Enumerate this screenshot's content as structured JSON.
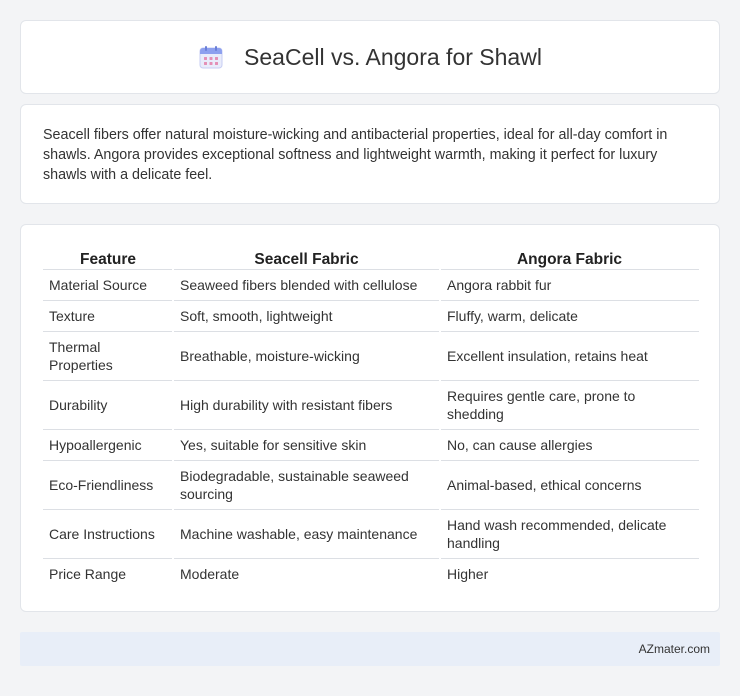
{
  "header": {
    "title": "SeaCell vs. Angora for Shawl",
    "icon": "calendar-icon"
  },
  "summary": {
    "text": "Seacell fibers offer natural moisture-wicking and antibacterial properties, ideal for all-day comfort in shawls. Angora provides exceptional softness and lightweight warmth, making it perfect for luxury shawls with a delicate feel."
  },
  "table": {
    "headers": [
      "Feature",
      "Seacell Fabric",
      "Angora Fabric"
    ],
    "rows": [
      [
        "Material Source",
        "Seaweed fibers blended with cellulose",
        "Angora rabbit fur"
      ],
      [
        "Texture",
        "Soft, smooth, lightweight",
        "Fluffy, warm, delicate"
      ],
      [
        "Thermal Properties",
        "Breathable, moisture-wicking",
        "Excellent insulation, retains heat"
      ],
      [
        "Durability",
        "High durability with resistant fibers",
        "Requires gentle care, prone to shedding"
      ],
      [
        "Hypoallergenic",
        "Yes, suitable for sensitive skin",
        "No, can cause allergies"
      ],
      [
        "Eco-Friendliness",
        "Biodegradable, sustainable seaweed sourcing",
        "Animal-based, ethical concerns"
      ],
      [
        "Care Instructions",
        "Machine washable, easy maintenance",
        "Hand wash recommended, delicate handling"
      ],
      [
        "Price Range",
        "Moderate",
        "Higher"
      ]
    ]
  },
  "footer": {
    "text": "AZmater.com"
  },
  "colors": {
    "background": "#f3f4f6",
    "card": "#ffffff",
    "footer": "#e8eef8",
    "icon_accent": "#7b8fe8"
  }
}
